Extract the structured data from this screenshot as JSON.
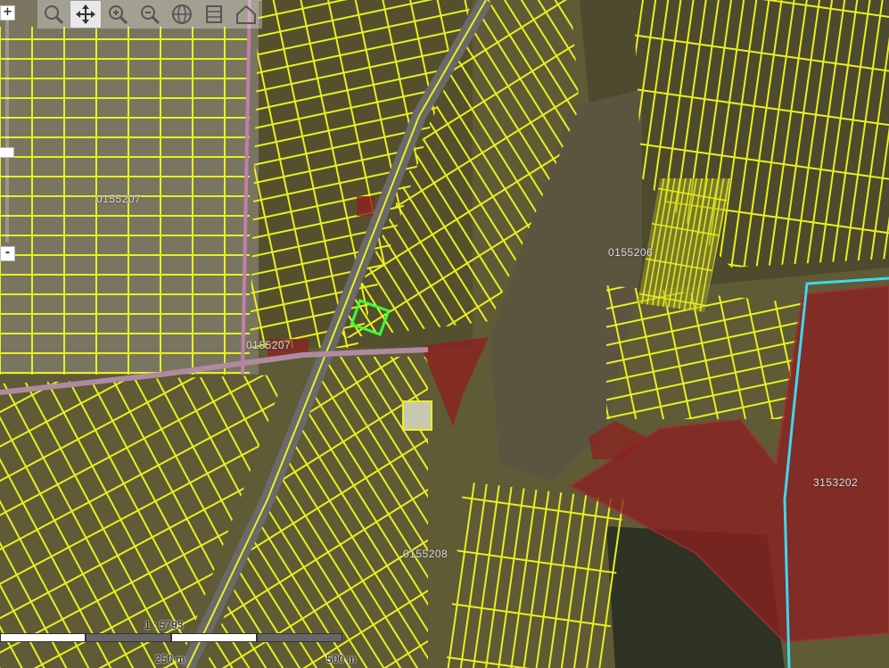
{
  "map": {
    "parcel_labels": [
      "0155207",
      "0155207",
      "0155206",
      "0155208",
      "3153202"
    ],
    "colors": {
      "parcel_outline": "#e8f020",
      "selected_outline": "#3cff3c",
      "restricted_fill": "#8b2020",
      "boundary": "#3fd6f0",
      "road": "#6a6a6a"
    }
  },
  "toolbar": {
    "tools": [
      {
        "icon": "zoom-box-icon"
      },
      {
        "icon": "pan-icon",
        "active": true
      },
      {
        "icon": "zoom-in-icon"
      },
      {
        "icon": "zoom-out-icon"
      },
      {
        "icon": "full-extent-icon"
      },
      {
        "icon": "layers-icon"
      },
      {
        "icon": "home-icon"
      }
    ]
  },
  "zoom": {
    "plus": "+",
    "minus": "-",
    "level": 0.6
  },
  "scale": {
    "ratio": "1 : 5793",
    "label_mid": "250 m",
    "label_end": "500 m"
  }
}
